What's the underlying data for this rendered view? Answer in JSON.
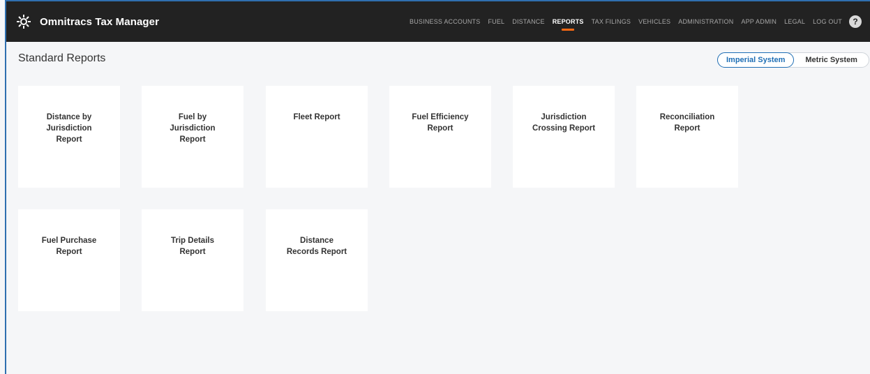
{
  "app": {
    "title": "Omnitracs Tax Manager",
    "icon": "sun-gear-icon"
  },
  "nav": {
    "items": [
      {
        "label": "BUSINESS ACCOUNTS"
      },
      {
        "label": "FUEL"
      },
      {
        "label": "DISTANCE"
      },
      {
        "label": "REPORTS",
        "active": true
      },
      {
        "label": "TAX FILINGS"
      },
      {
        "label": "VEHICLES"
      },
      {
        "label": "ADMINISTRATION"
      },
      {
        "label": "APP ADMIN"
      },
      {
        "label": "LEGAL"
      },
      {
        "label": "LOG OUT"
      }
    ],
    "help_label": "?"
  },
  "page": {
    "title": "Standard Reports"
  },
  "units_toggle": {
    "options": [
      {
        "label": "Imperial System",
        "selected": true
      },
      {
        "label": "Metric System",
        "selected": false
      }
    ]
  },
  "reports": [
    {
      "label": "Distance by\nJurisdiction\nReport"
    },
    {
      "label": "Fuel by\nJurisdiction\nReport"
    },
    {
      "label": "Fleet Report"
    },
    {
      "label": "Fuel Efficiency\nReport"
    },
    {
      "label": "Jurisdiction\nCrossing Report"
    },
    {
      "label": "Reconciliation\nReport"
    },
    {
      "label": "Fuel Purchase\nReport"
    },
    {
      "label": "Trip Details\nReport"
    },
    {
      "label": "Distance\nRecords Report"
    }
  ],
  "colors": {
    "topbar": "#222222",
    "accent": "#ff6a13",
    "toggle_active": "#1e6eb5",
    "background": "#f5f6f8"
  }
}
